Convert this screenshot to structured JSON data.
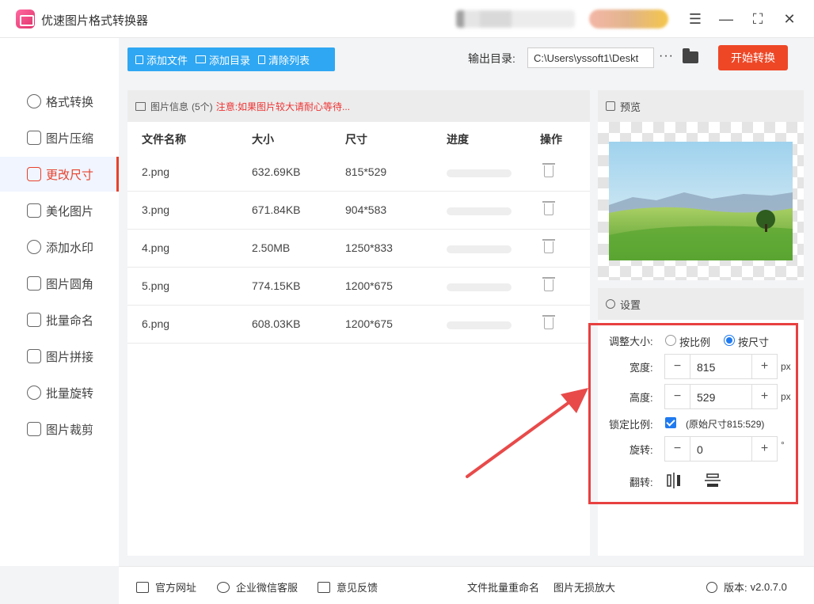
{
  "app": {
    "title": "优速图片格式转换器"
  },
  "window": {
    "menu_icon": "☰",
    "minimize_icon": "—",
    "maximize_icon": "⛶",
    "close_icon": "✕"
  },
  "sidebar": {
    "items": [
      {
        "label": "格式转换",
        "icon": "convert-icon"
      },
      {
        "label": "图片压缩",
        "icon": "compress-icon"
      },
      {
        "label": "更改尺寸",
        "icon": "resize-icon",
        "active": true
      },
      {
        "label": "美化图片",
        "icon": "beautify-icon"
      },
      {
        "label": "添加水印",
        "icon": "watermark-icon"
      },
      {
        "label": "图片圆角",
        "icon": "rounded-corner-icon"
      },
      {
        "label": "批量命名",
        "icon": "rename-icon"
      },
      {
        "label": "图片拼接",
        "icon": "stitch-icon"
      },
      {
        "label": "批量旋转",
        "icon": "rotate-icon"
      },
      {
        "label": "图片裁剪",
        "icon": "crop-icon"
      }
    ]
  },
  "toolbar": {
    "add_file": "添加文件",
    "add_folder": "添加目录",
    "clear_list": "清除列表",
    "output_label": "输出目录:",
    "output_path": "C:\\Users\\yssoft1\\Deskt",
    "more": "···",
    "start": "开始转换"
  },
  "file_list": {
    "header_title": "图片信息",
    "count": "(5个)",
    "notice": "注意:如果图片较大请耐心等待...",
    "columns": {
      "name": "文件名称",
      "size": "大小",
      "dimensions": "尺寸",
      "progress": "进度",
      "actions": "操作"
    },
    "rows": [
      {
        "name": "2.png",
        "size": "632.69KB",
        "dimensions": "815*529",
        "progress": 0
      },
      {
        "name": "3.png",
        "size": "671.84KB",
        "dimensions": "904*583",
        "progress": 0
      },
      {
        "name": "4.png",
        "size": "2.50MB",
        "dimensions": "1250*833",
        "progress": 0
      },
      {
        "name": "5.png",
        "size": "774.15KB",
        "dimensions": "1200*675",
        "progress": 0
      },
      {
        "name": "6.png",
        "size": "608.03KB",
        "dimensions": "1200*675",
        "progress": 0
      }
    ]
  },
  "preview": {
    "title": "预览"
  },
  "settings": {
    "title": "设置",
    "resize_label": "调整大小:",
    "by_ratio": "按比例",
    "by_size": "按尺寸",
    "selected_mode": "by_size",
    "width_label": "宽度:",
    "width_value": "815",
    "height_label": "高度:",
    "height_value": "529",
    "unit": "px",
    "lock_label": "锁定比例:",
    "lock_checked": true,
    "original_size": "(原始尺寸815:529)",
    "rotate_label": "旋转:",
    "rotate_value": "0",
    "degree": "°",
    "flip_label": "翻转:",
    "minus": "−",
    "plus": "+"
  },
  "footer": {
    "website": "官方网址",
    "wechat": "企业微信客服",
    "feedback": "意见反馈",
    "batch_rename": "文件批量重命名",
    "lossless_zoom": "图片无损放大",
    "version_label": "版本:",
    "version": "v2.0.7.0"
  },
  "colors": {
    "accent_red": "#e8412c",
    "toolbar_blue": "#2fa7f3",
    "start_button": "#ee4726",
    "highlight_border": "#e84040"
  }
}
